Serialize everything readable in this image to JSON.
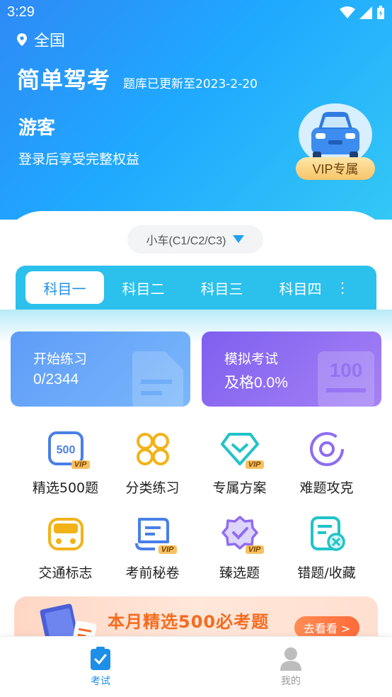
{
  "status_bar": {
    "time": "3:29"
  },
  "header": {
    "location": "全国",
    "app_title": "简单驾考",
    "bank_update": "题库已更新至2023-2-20",
    "user_name": "游客",
    "login_hint": "登录后享受完整权益",
    "vip_label": "VIP专属"
  },
  "license": {
    "selected": "小车(C1/C2/C3)"
  },
  "subject_tabs": {
    "items": [
      "科目一",
      "科目二",
      "科目三",
      "科目四"
    ],
    "active_index": 0
  },
  "cards": {
    "practice": {
      "title": "开始练习",
      "value": "0/2344"
    },
    "exam": {
      "title": "模拟考试",
      "value": "及格0.0%"
    }
  },
  "features": [
    {
      "label": "精选500题",
      "icon": "500-questions-icon",
      "vip": true
    },
    {
      "label": "分类练习",
      "icon": "category-grid-icon",
      "vip": false
    },
    {
      "label": "专属方案",
      "icon": "diamond-icon",
      "vip": true
    },
    {
      "label": "难题攻克",
      "icon": "target-ring-icon",
      "vip": false
    },
    {
      "label": "交通标志",
      "icon": "traffic-sign-icon",
      "vip": false
    },
    {
      "label": "考前秘卷",
      "icon": "secret-paper-icon",
      "vip": true
    },
    {
      "label": "臻选题",
      "icon": "badge-check-icon",
      "vip": true
    },
    {
      "label": "错题/收藏",
      "icon": "wrong-questions-icon",
      "vip": false
    }
  ],
  "vip_tag": "VIP",
  "promo": {
    "title": "本月精选500必考题",
    "button": "去看看 >"
  },
  "bottom_nav": {
    "items": [
      {
        "label": "考试",
        "active": true
      },
      {
        "label": "我的",
        "active": false
      }
    ]
  },
  "colors": {
    "primary": "#1fa8ff",
    "tab_bar": "#2cc0ec",
    "practice_card": "#5e9cf8",
    "exam_card": "#8a6af1",
    "vip_gold": "#f6c160",
    "promo_orange": "#f56b1f"
  }
}
